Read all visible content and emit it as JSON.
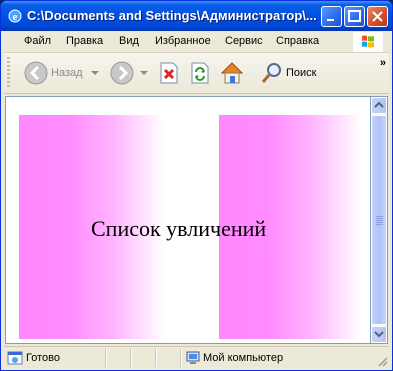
{
  "window": {
    "title": "C:\\Documents and Settings\\Администратор\\..."
  },
  "menu": {
    "items": [
      "Файл",
      "Правка",
      "Вид",
      "Избранное",
      "Сервис",
      "Справка"
    ]
  },
  "toolbar": {
    "back_label": "Назад",
    "search_label": "Поиск",
    "overflow_label": "»"
  },
  "page": {
    "text": "Список увличений"
  },
  "status": {
    "state": "Готово",
    "zone": "Мой компьютер"
  }
}
